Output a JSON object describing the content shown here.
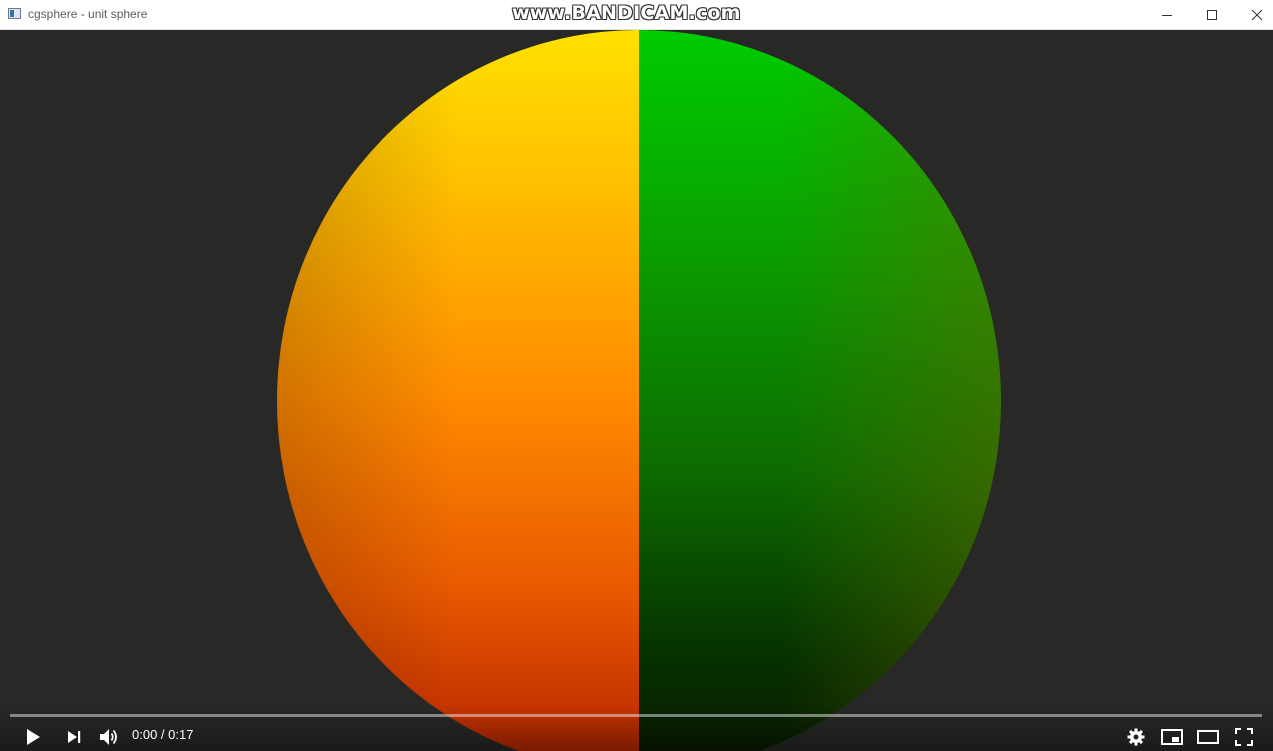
{
  "window": {
    "title": "cgsphere - unit sphere",
    "watermark": "www.BANDICAM.com",
    "controls": {
      "minimize_icon": "minimize-icon",
      "maximize_icon": "maximize-icon",
      "close_icon": "close-icon"
    }
  },
  "scene": {
    "background_color": "#282826",
    "object": "sphere",
    "left_hemisphere_colors": [
      "#ffe100",
      "#ff8a00",
      "#b52200"
    ],
    "right_hemisphere_colors": [
      "#00cc00",
      "#1a7a00",
      "#0a2a00"
    ]
  },
  "player": {
    "current_time": "0:00",
    "separator": " / ",
    "duration": "0:17",
    "progress": 0,
    "buttons": {
      "play_icon": "play-icon",
      "next_icon": "next-icon",
      "volume_icon": "volume-icon",
      "settings_icon": "gear-icon",
      "miniplayer_icon": "miniplayer-icon",
      "theater_icon": "theater-mode-icon",
      "fullscreen_icon": "fullscreen-icon"
    }
  }
}
